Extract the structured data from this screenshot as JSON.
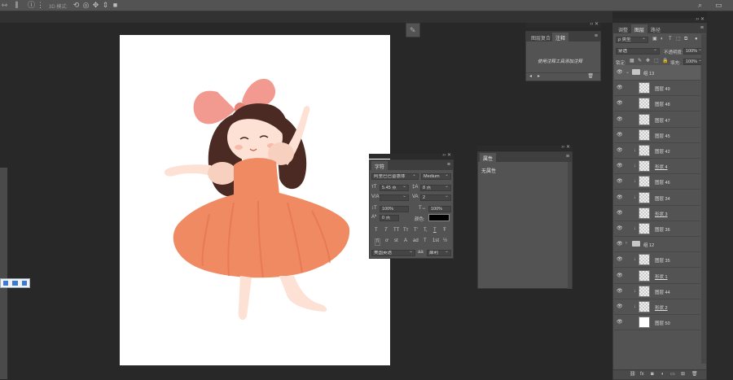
{
  "options_bar": {
    "label_3d": "3D 模式:",
    "icons": [
      "move-tool-icon",
      "align-icon",
      "info-icon",
      "rotate-3d-icon",
      "roll-3d-icon",
      "drag-3d-icon",
      "slide-3d-icon",
      "scale-3d-icon"
    ],
    "right_icons": [
      "search-icon",
      "workspace-icon"
    ]
  },
  "notes_panel": {
    "tabs": [
      "图层复合",
      "注释"
    ],
    "active_tab": "注释",
    "body": "使用注释工具添加注释"
  },
  "properties_panel": {
    "tab": "属性",
    "body": "无属性"
  },
  "character_panel": {
    "tab": "字符",
    "font_family": "阿里巴巴普惠体",
    "font_style": "Medium",
    "font_size": "5.45 点",
    "leading": "8 点",
    "kerning": "",
    "tracking": "2",
    "vertical_scale": "100%",
    "horizontal_scale": "100%",
    "baseline_shift": "0 点",
    "color_label": "颜色:",
    "text_color": "#000000",
    "style_buttons": [
      "T",
      "T",
      "TT",
      "Tт",
      "T'",
      "T,",
      "T",
      "Ŧ"
    ],
    "opentype_buttons": [
      "fi",
      "ơ",
      "st",
      "A",
      "ad",
      "T",
      "1st",
      "½"
    ],
    "language": "美国英语",
    "aa_label": "aa",
    "antialias": "犀利"
  },
  "layers_panel": {
    "tabs": [
      "调整",
      "图层",
      "路径"
    ],
    "active_tab": "图层",
    "filter_kind": "ρ 类型",
    "blend_mode": "穿透",
    "opacity_label": "不透明度:",
    "opacity": "100%",
    "lock_label": "锁定:",
    "fill_label": "填充:",
    "fill": "100%",
    "layers": [
      {
        "name": "组 13",
        "type": "group",
        "expanded": true
      },
      {
        "name": "图层 49",
        "type": "layer"
      },
      {
        "name": "图层 48",
        "type": "layer"
      },
      {
        "name": "图层 47",
        "type": "layer"
      },
      {
        "name": "图层 45",
        "type": "layer"
      },
      {
        "name": "图层 42",
        "type": "layer",
        "clipped": true
      },
      {
        "name": "形状 4",
        "type": "shape",
        "clipped": true
      },
      {
        "name": "图层 46",
        "type": "layer",
        "clipped": true
      },
      {
        "name": "图层 34",
        "type": "layer",
        "clipped": true
      },
      {
        "name": "形状 3",
        "type": "shape"
      },
      {
        "name": "图层 36",
        "type": "layer",
        "clipped": true
      },
      {
        "name": "组 12",
        "type": "group",
        "expanded": false
      },
      {
        "name": "图层 35",
        "type": "layer",
        "clipped": true
      },
      {
        "name": "形状 1",
        "type": "shape"
      },
      {
        "name": "图层 44",
        "type": "layer",
        "clipped": true
      },
      {
        "name": "形状 2",
        "type": "shape",
        "clipped": true
      },
      {
        "name": "图层 50",
        "type": "layer",
        "white": true
      }
    ],
    "footer_icons": [
      "link-icon",
      "fx-icon",
      "mask-icon",
      "adjustment-icon",
      "folder-icon",
      "new-layer-icon",
      "trash-icon"
    ]
  },
  "colors": {
    "dress": "#f08a63",
    "dress_shade": "#e2704d",
    "skin": "#fde1d4",
    "hair": "#4a2a22",
    "bow": "#f29a8f",
    "workspace": "#282828",
    "panel": "#535353"
  }
}
